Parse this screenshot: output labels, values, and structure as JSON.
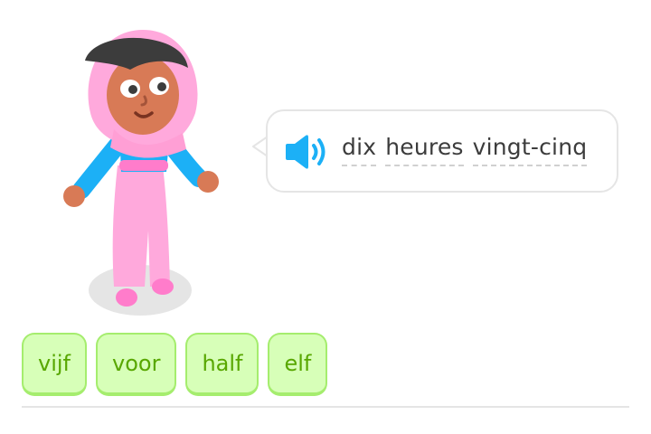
{
  "prompt": {
    "speaker_icon": "speaker-icon",
    "words": [
      "dix",
      "heures",
      "vingt-cinq"
    ]
  },
  "word_bank": {
    "chips": [
      "vijf",
      "voor",
      "half",
      "elf"
    ]
  },
  "colors": {
    "accent_blue": "#1cb0f6",
    "chip_bg": "#d7ffb8",
    "chip_border": "#a5ed6e",
    "chip_text": "#58a700",
    "bubble_border": "#e5e5e5",
    "text": "#3c3c3c"
  }
}
